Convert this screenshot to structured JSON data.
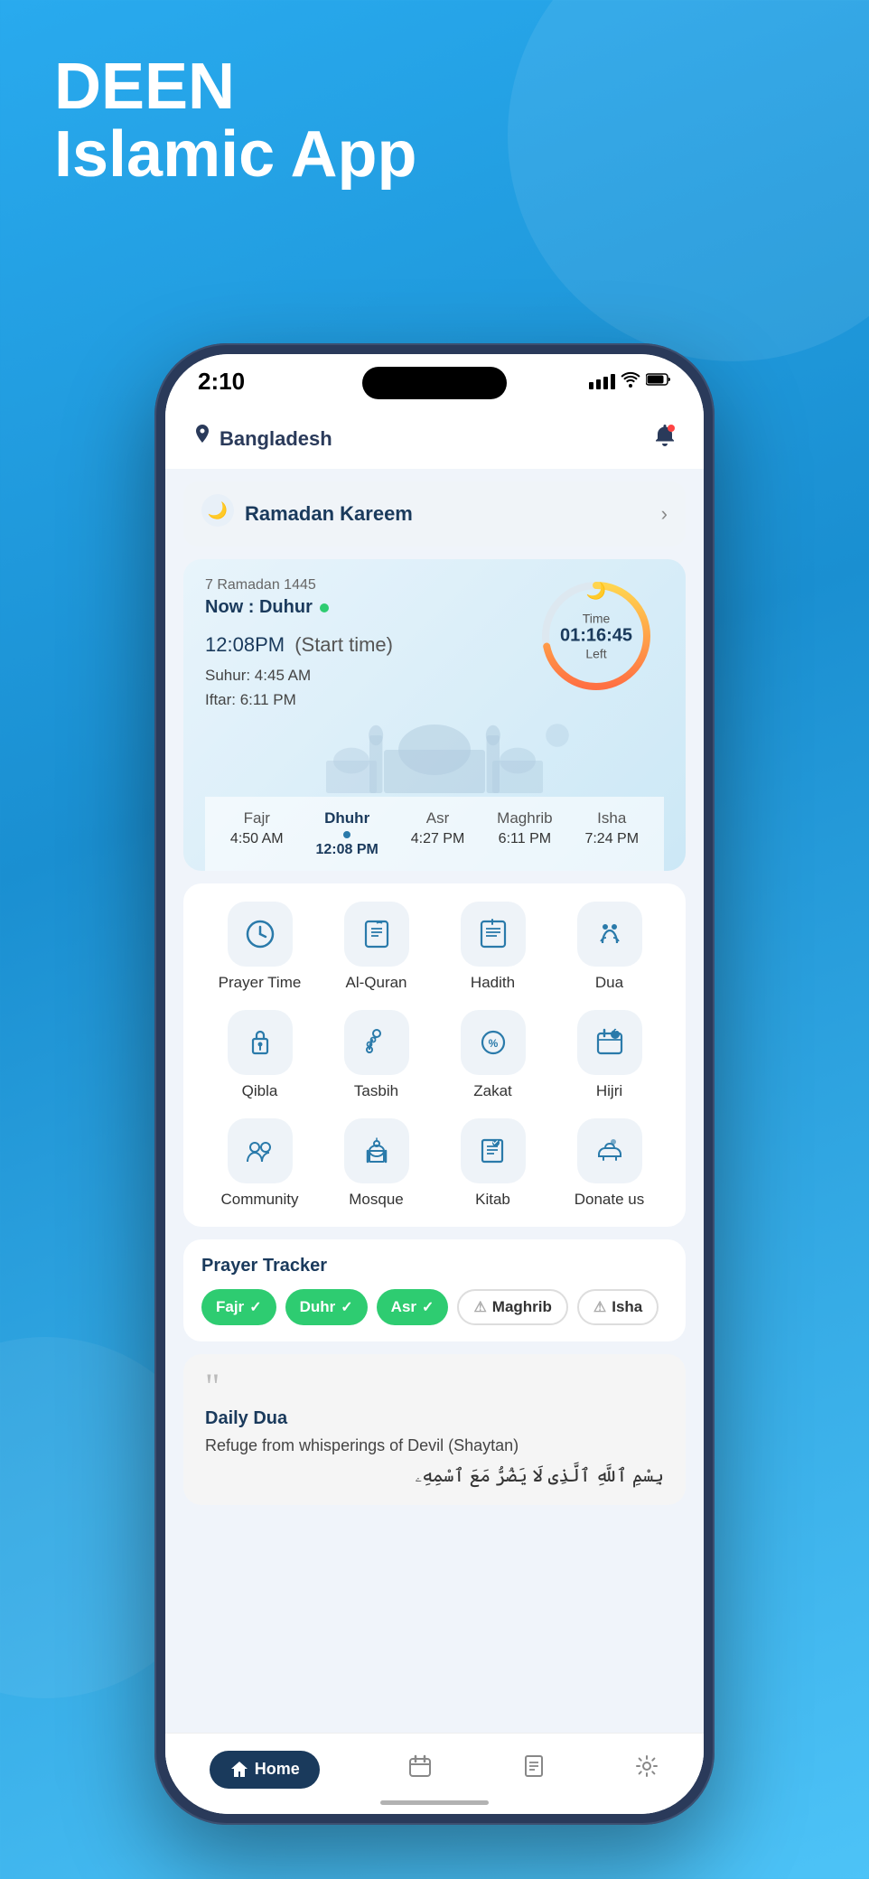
{
  "background": {
    "color": "#29aaee"
  },
  "app_title": {
    "line1": "DEEN",
    "line2": "Islamic App"
  },
  "status_bar": {
    "time": "2:10",
    "signal": "...",
    "wifi": "wifi",
    "battery": "battery"
  },
  "header": {
    "location": "Bangladesh",
    "location_icon": "📍",
    "bell_icon": "🔔"
  },
  "ramadan_banner": {
    "icon": "🕌",
    "text": "Ramadan Kareem"
  },
  "prayer_card": {
    "hijri_date": "7 Ramadan 1445",
    "now_label": "Now : Duhur",
    "prayer_time": "12:08",
    "period": "PM",
    "start_time_label": "(Start time)",
    "suhur": "Suhur: 4:45 AM",
    "iftar": "Iftar: 6:11 PM",
    "countdown_label": "Time",
    "countdown_time": "01:16:45",
    "countdown_left": "Left"
  },
  "prayer_times": [
    {
      "name": "Fajr",
      "time": "4:50 AM",
      "active": false
    },
    {
      "name": "Dhuhr",
      "time": "12:08 PM",
      "active": true
    },
    {
      "name": "Asr",
      "time": "4:27 PM",
      "active": false
    },
    {
      "name": "Maghrib",
      "time": "6:11 PM",
      "active": false
    },
    {
      "name": "Isha",
      "time": "7:24 PM",
      "active": false
    }
  ],
  "icon_grid": [
    {
      "icon": "🕐",
      "label": "Prayer Time"
    },
    {
      "icon": "📖",
      "label": "Al-Quran"
    },
    {
      "icon": "📚",
      "label": "Hadith"
    },
    {
      "icon": "🤲",
      "label": "Dua"
    },
    {
      "icon": "🕋",
      "label": "Qibla"
    },
    {
      "icon": "📿",
      "label": "Tasbih"
    },
    {
      "icon": "💰",
      "label": "Zakat"
    },
    {
      "icon": "📅",
      "label": "Hijri"
    },
    {
      "icon": "👥",
      "label": "Community"
    },
    {
      "icon": "🕌",
      "label": "Mosque"
    },
    {
      "icon": "📒",
      "label": "Kitab"
    },
    {
      "icon": "🤝",
      "label": "Donate us"
    }
  ],
  "prayer_tracker": {
    "title": "Prayer Tracker",
    "pills": [
      {
        "name": "Fajr",
        "status": "completed"
      },
      {
        "name": "Duhr",
        "status": "completed"
      },
      {
        "name": "Asr",
        "status": "completed"
      },
      {
        "name": "Maghrib",
        "status": "missed"
      },
      {
        "name": "Isha",
        "status": "missed"
      }
    ]
  },
  "daily_dua": {
    "title": "Daily Dua",
    "subtitle": "Refuge from whisperings of Devil (Shaytan)",
    "arabic_text": "بِسْمِ اللَّهِ الَّذِي لَا يَضُرُّ"
  },
  "bottom_nav": [
    {
      "icon": "🏠",
      "label": "Home",
      "active": true
    },
    {
      "icon": "📅",
      "label": "Calendar",
      "active": false
    },
    {
      "icon": "📖",
      "label": "Quran",
      "active": false
    },
    {
      "icon": "⚙️",
      "label": "Settings",
      "active": false
    }
  ]
}
